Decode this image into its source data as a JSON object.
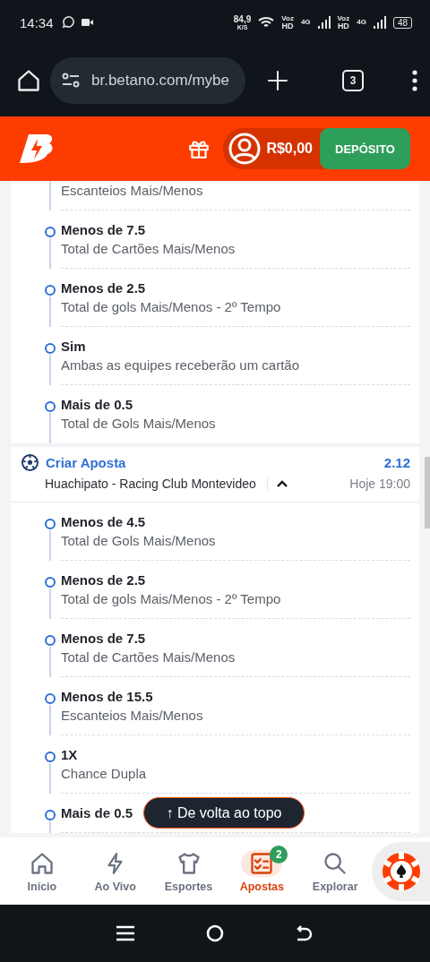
{
  "status_bar": {
    "time": "14:34",
    "net_speed": "84,9",
    "net_unit": "K/S",
    "sims": [
      {
        "voice": "Voz",
        "hd": "HD",
        "network": "4G"
      },
      {
        "voice": "Voz",
        "hd": "HD",
        "network": "4G"
      }
    ],
    "battery": "48"
  },
  "browser": {
    "url": "br.betano.com/mybe",
    "tab_count": "3"
  },
  "header": {
    "balance": "R$0,00",
    "deposit_button": "DEPÓSITO"
  },
  "bets": [
    {
      "kind": "continued",
      "legs": [
        {
          "subtitle": "Escanteios Mais/Menos"
        },
        {
          "title": "Menos de 7.5",
          "subtitle": "Total de Cartões Mais/Menos"
        },
        {
          "title": "Menos de 2.5",
          "subtitle": "Total de gols Mais/Menos - 2º Tempo"
        },
        {
          "title": "Sim",
          "subtitle": "Ambas as equipes receberão um cartão"
        },
        {
          "title": "Mais de 0.5",
          "subtitle": "Total de Gols Mais/Menos"
        }
      ]
    },
    {
      "kind": "builder",
      "title": "Criar Aposta",
      "odds": "2.12",
      "match": "Huachipato - Racing Club Montevideo",
      "time": "Hoje 19:00",
      "expanded": true,
      "legs": [
        {
          "title": "Menos de 4.5",
          "subtitle": "Total de Gols Mais/Menos"
        },
        {
          "title": "Menos de 2.5",
          "subtitle": "Total de gols Mais/Menos - 2º Tempo"
        },
        {
          "title": "Menos de 7.5",
          "subtitle": "Total de Cartões Mais/Menos"
        },
        {
          "title": "Menos de 15.5",
          "subtitle": "Escanteios Mais/Menos"
        },
        {
          "title": "1X",
          "subtitle": "Chance Dupla"
        },
        {
          "title": "Mais de 0.5"
        }
      ]
    }
  ],
  "back_to_top": "↑ De volta ao topo",
  "bottom_nav": [
    {
      "kind": "home",
      "label": "Início",
      "selected": false
    },
    {
      "kind": "live",
      "label": "Ao Vivo",
      "selected": false
    },
    {
      "kind": "sports",
      "label": "Esportes",
      "selected": false
    },
    {
      "kind": "bets",
      "label": "Apostas",
      "selected": true,
      "badge": "2"
    },
    {
      "kind": "explore",
      "label": "Explorar",
      "selected": false
    }
  ]
}
